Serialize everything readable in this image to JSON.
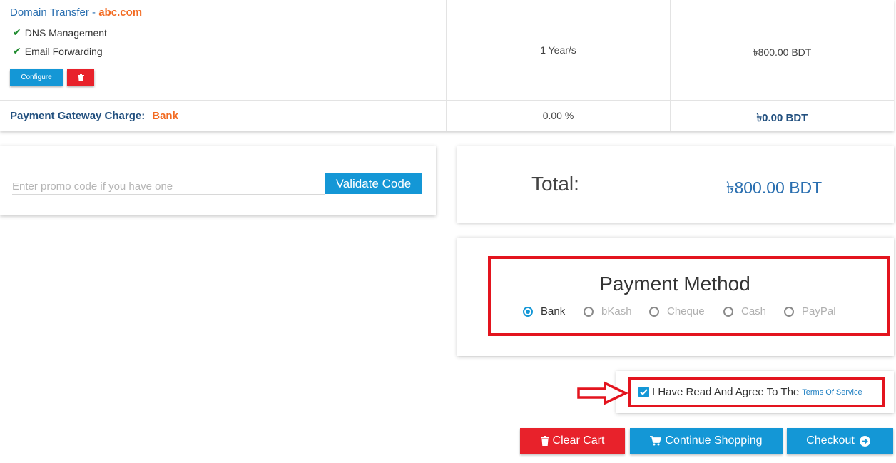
{
  "cart": {
    "item": {
      "title_prefix": "Domain Transfer - ",
      "domain": "abc.com",
      "features": [
        "DNS Management",
        "Email Forwarding"
      ],
      "configure_label": "Configure",
      "period": "1 Year/s",
      "price": "৳800.00 BDT"
    },
    "gateway": {
      "label": "Payment Gateway Charge:",
      "method": "Bank",
      "percent": "0.00 %",
      "amount": "৳0.00 BDT"
    }
  },
  "promo": {
    "placeholder": "Enter promo code if you have one",
    "validate_label": "Validate Code"
  },
  "total": {
    "label": "Total:",
    "value": "৳800.00 BDT"
  },
  "payment_method": {
    "title": "Payment Method",
    "options": [
      {
        "label": "Bank",
        "selected": true
      },
      {
        "label": "bKash",
        "selected": false
      },
      {
        "label": "Cheque",
        "selected": false
      },
      {
        "label": "Cash",
        "selected": false
      },
      {
        "label": "PayPal",
        "selected": false
      }
    ]
  },
  "terms": {
    "text": "I Have Read And Agree To The",
    "link": "Terms Of Service",
    "checked": true
  },
  "actions": {
    "clear_cart": "Clear Cart",
    "continue_shopping": "Continue Shopping",
    "checkout": "Checkout"
  },
  "colors": {
    "primary": "#1497d6",
    "danger": "#e8222b",
    "accent_orange": "#f26b22",
    "heading_blue": "#22507f",
    "highlight_red": "#e3141e"
  },
  "icons": {
    "feature": "check-icon",
    "remove": "trash-icon",
    "clear_cart": "trash-icon",
    "continue_shopping": "cart-icon",
    "checkout": "arrow-circle-right-icon"
  }
}
